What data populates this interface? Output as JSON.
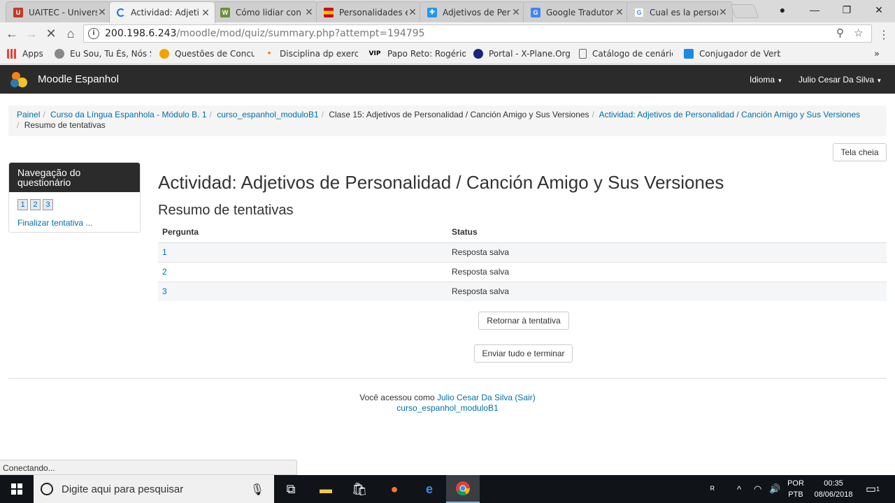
{
  "browser": {
    "tabs": [
      {
        "title": "UAITEC - Univers",
        "favicon_color": "#c0392b"
      },
      {
        "title": "Actividad: Adjeti",
        "favicon_color": "#1a73e8",
        "active": true
      },
      {
        "title": "Cómo lidiar con",
        "favicon_color": "#6a8f3a"
      },
      {
        "title": "Personalidades e",
        "favicon_color": "#d4aa00"
      },
      {
        "title": "Adjetivos de Per",
        "favicon_color": "#2196f3"
      },
      {
        "title": "Google Tradutor",
        "favicon_color": "#4285f4"
      },
      {
        "title": "Cual es la persor",
        "favicon_color": "#ea4335"
      }
    ],
    "address": {
      "host": "200.198.6.243",
      "path": "/moodle/mod/quiz/summary.php?attempt=194795"
    },
    "bookmarks": [
      {
        "label": "Apps",
        "color": "#e94235"
      },
      {
        "label": "Eu Sou, Tu És, Nós S",
        "color": "#888888"
      },
      {
        "label": "Questões de Concur",
        "color": "#f4a100"
      },
      {
        "label": "Disciplina dp exercic",
        "color": "#e8710a"
      },
      {
        "label": "Papo Reto: Rogério F",
        "color": "#000000"
      },
      {
        "label": "Portal - X-Plane.Org",
        "color": "#1a237e"
      },
      {
        "label": "Catálogo de cenário",
        "color": "#666666"
      },
      {
        "label": "Conjugador de Verb",
        "color": "#1e88e5"
      }
    ],
    "status": "Conectando..."
  },
  "moodle": {
    "site_name": "Moodle Espanhol",
    "menu_language": "Idioma",
    "menu_user": "Julio Cesar Da Silva",
    "breadcrumb": [
      {
        "label": "Painel",
        "link": true
      },
      {
        "label": "Curso da Língua Espanhola - Módulo B. 1",
        "link": true
      },
      {
        "label": "curso_espanhol_moduloB1",
        "link": true
      },
      {
        "label": "Clase 15: Adjetivos de Personalidad / Canción Amigo y Sus Versiones",
        "link": false
      },
      {
        "label": "Actividad: Adjetivos de Personalidad / Canción Amigo y Sus Versiones",
        "link": true
      },
      {
        "label": "Resumo de tentativas",
        "link": false
      }
    ],
    "fullscreen_label": "Tela cheia",
    "quiz_nav": {
      "title": "Navegação do questionário",
      "buttons": [
        "1",
        "2",
        "3"
      ],
      "finish": "Finalizar tentativa ..."
    },
    "title": "Actividad: Adjetivos de Personalidad / Canción Amigo y Sus Versiones",
    "subtitle": "Resumo de tentativas",
    "table": {
      "headers": [
        "Pergunta",
        "Status"
      ],
      "rows": [
        {
          "q": "1",
          "status": "Resposta salva"
        },
        {
          "q": "2",
          "status": "Resposta salva"
        },
        {
          "q": "3",
          "status": "Resposta salva"
        }
      ]
    },
    "return_button": "Retornar à tentativa",
    "submit_button": "Enviar tudo e terminar",
    "footer": {
      "prefix": "Você acessou como",
      "user": "Julio Cesar Da Silva",
      "logout": "(Sair)",
      "course": "curso_espanhol_moduloB1"
    }
  },
  "taskbar": {
    "search_placeholder": "Digite aqui para pesquisar",
    "lang_top": "POR",
    "lang_bottom": "PTB",
    "time": "00:35",
    "date": "08/06/2018",
    "notification_count": "1"
  }
}
